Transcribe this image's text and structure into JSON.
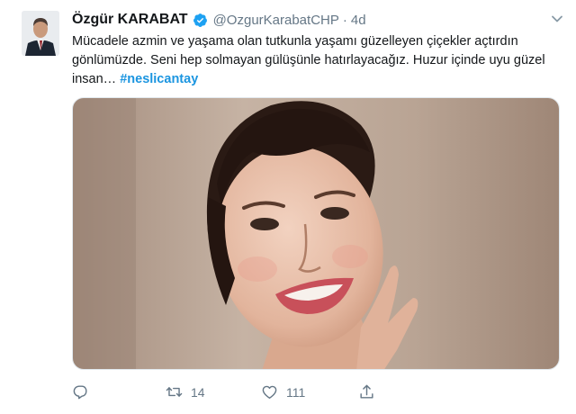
{
  "author": {
    "display_name": "Özgür KARABAT",
    "handle": "@OzgurKarabatCHP",
    "separator": "·",
    "time": "4d",
    "verified": true
  },
  "tweet": {
    "text": "Mücadele azmin ve yaşama olan tutkunla yaşamı güzelleyen çiçekler açtırdın gönlümüzde. Seni hep solmayan gülüşünle hatırlayacağız. Huzur içinde uyu güzel insan…",
    "hashtag": "#neslicantay"
  },
  "actions": {
    "reply_count": "",
    "retweet_count": "14",
    "like_count": "111"
  },
  "icons": {
    "reply": "reply-icon",
    "retweet": "retweet-icon",
    "like": "heart-icon",
    "share": "share-icon",
    "verified": "verified-badge-icon",
    "menu": "chevron-down-icon"
  },
  "colors": {
    "link": "#1b95e0",
    "verified": "#1da1f2",
    "muted": "#657786",
    "text": "#14171a"
  }
}
